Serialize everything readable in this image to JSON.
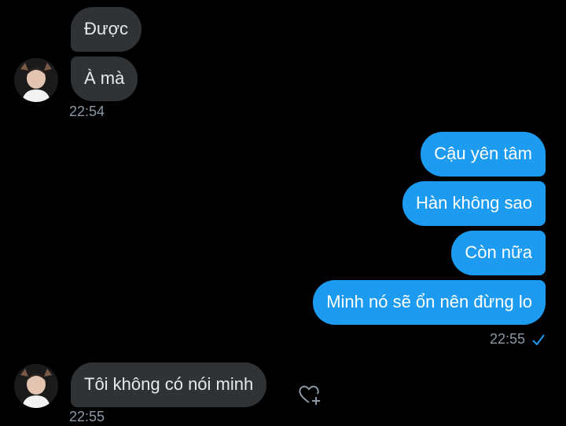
{
  "conversation": {
    "group1": {
      "messages": [
        "Được",
        "À mà"
      ],
      "time": "22:54"
    },
    "group2": {
      "messages": [
        "Cậu yên tâm",
        "Hàn không sao",
        "Còn nữa",
        "Minh nó sẽ ổn nên đừng lo"
      ],
      "time": "22:55"
    },
    "group3": {
      "messages": [
        "Tôi không có nói minh"
      ],
      "time": "22:55"
    }
  },
  "colors": {
    "background": "#000000",
    "incoming_bubble": "#2f3336",
    "outgoing_bubble": "#1d9bf0",
    "timestamp": "#8b98a5"
  },
  "icons": {
    "read_receipt": "checkmark-icon",
    "react": "heart-plus-icon"
  }
}
